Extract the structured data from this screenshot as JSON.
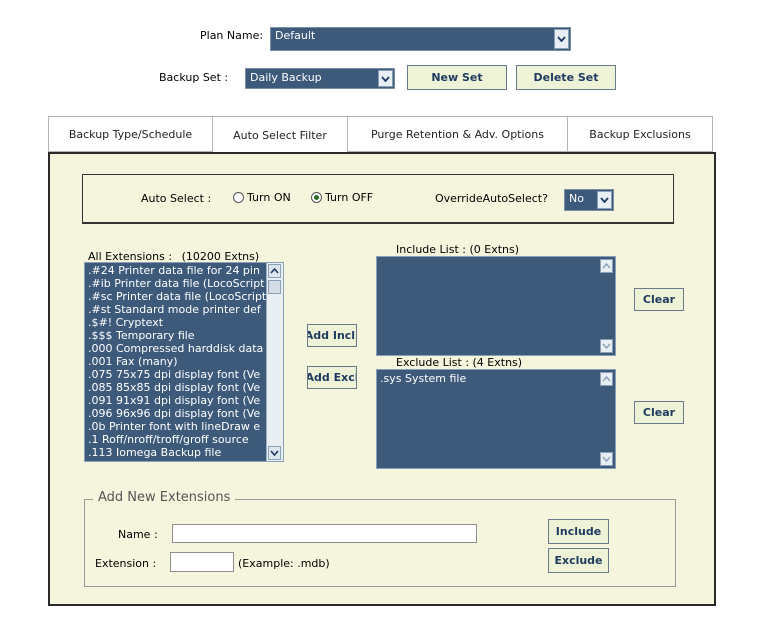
{
  "header": {
    "plan_name_label": "Plan Name:",
    "plan_name_value": "Default",
    "backup_set_label": "Backup Set :",
    "backup_set_value": "Daily Backup",
    "new_set_button": "New Set",
    "delete_set_button": "Delete Set"
  },
  "tabs": [
    {
      "label": "Backup Type/Schedule",
      "active": false
    },
    {
      "label": "Auto Select Filter",
      "active": true
    },
    {
      "label": "Purge Retention & Adv. Options",
      "active": false
    },
    {
      "label": "Backup Exclusions",
      "active": false
    }
  ],
  "auto_select": {
    "label": "Auto Select :",
    "turn_on_label": "Turn ON",
    "turn_off_label": "Turn OFF",
    "selected": "Turn OFF",
    "override_label": "OverrideAutoSelect?",
    "override_value": "No"
  },
  "all_extensions": {
    "label": "All Extensions :",
    "count_label": "(10200 Extns)",
    "items": [
      ".#24 Printer data file for 24 pin",
      ".#ib Printer data file (LocoScript",
      ".#sc Printer data file (LocoScript",
      ".#st Standard mode printer def",
      ".$#! Cryptext",
      ".$$$ Temporary file",
      ".000 Compressed harddisk data",
      ".001 Fax (many)",
      ".075 75x75 dpi display font (Ve",
      ".085 85x85 dpi display font (Ve",
      ".091 91x91 dpi display font (Ve",
      ".096 96x96 dpi display font (Ve",
      ".0b Printer font with lineDraw e",
      ".1 Roff/nroff/troff/groff source",
      ".113 Iomega Backup file"
    ]
  },
  "actions": {
    "add_include": "Add Incl.",
    "add_exclude": "Add Excl"
  },
  "include_list": {
    "label": "Include List : (0 Extns)",
    "items": [],
    "clear_button": "Clear"
  },
  "exclude_list": {
    "label": "Exclude List : (4 Extns)",
    "items": [
      ".sys System file"
    ],
    "clear_button": "Clear"
  },
  "add_new": {
    "legend": "Add New Extensions",
    "name_label": "Name :",
    "name_value": "",
    "extension_label": "Extension :",
    "extension_value": "",
    "example_label": "(Example: .mdb)",
    "include_button": "Include",
    "exclude_button": "Exclude"
  },
  "icons": {
    "dropdown": "chevron-down-icon",
    "scroll_up": "chevron-up-icon",
    "scroll_down": "chevron-down-icon"
  },
  "colors": {
    "list_bg": "#3d5a7a",
    "panel_bg": "#f5f5dd",
    "button_bg": "#eef3d8",
    "button_text": "#1f3a5f"
  }
}
